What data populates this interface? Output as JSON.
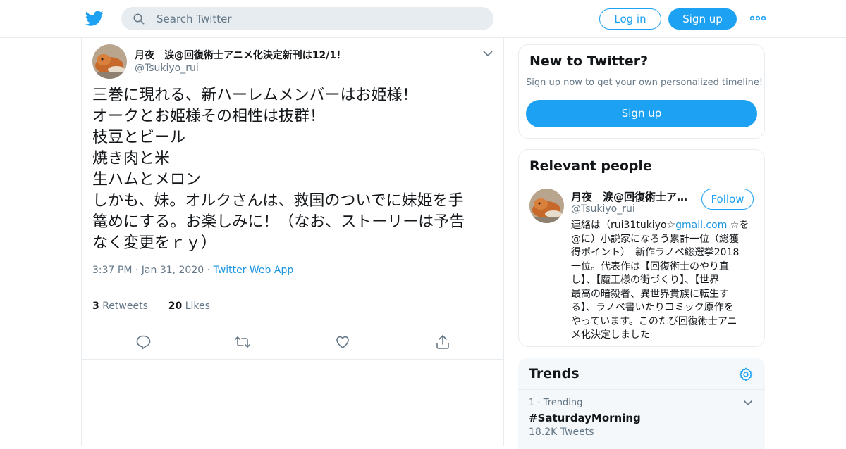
{
  "topbar": {
    "search_placeholder": "Search Twitter",
    "login_label": "Log in",
    "signup_label": "Sign up"
  },
  "tweet": {
    "display_name": "月夜　涙@回復術士アニメ化決定新刊は12/1！",
    "handle": "@Tsukiyo_rui",
    "lines": [
      "三巻に現れる、新ハーレムメンバーはお姫様！",
      "オークとお姫様その相性は抜群！",
      "枝豆とビール",
      "焼き肉と米",
      "生ハムとメロン",
      "しかも、妹。オルクさんは、救国のついでに妹姫を手",
      "篭めにする。お楽しみに！（なお、ストーリーは予告",
      "なく変更をｒｙ）"
    ],
    "time": "3:37 PM",
    "date": "Jan 31, 2020",
    "source": "Twitter Web App",
    "retweets_count": "3",
    "retweets_label": "Retweets",
    "likes_count": "20",
    "likes_label": "Likes"
  },
  "new_to_twitter": {
    "title": "New to Twitter?",
    "subtitle": "Sign up now to get your own personalized timeline!",
    "signup_label": "Sign up"
  },
  "relevant_people": {
    "title": "Relevant people",
    "name": "月夜　涙@回復術士ア…",
    "handle": "@Tsukiyo_rui",
    "follow_label": "Follow",
    "bio_prefix": "連絡は（rui31tukiyo☆",
    "bio_link": "gmail.com",
    "bio_lines": [
      "☆を",
      "@に）小説家になろう累計一位（総獲",
      "得ポイント）　新作ラノベ総選挙2018",
      "一位。代表作は【回復術士のやり直",
      "し】、【魔王様の街づくり】、【世界",
      "最高の暗殺者、異世界貴族に転生す",
      "る】、ラノベ書いたりコミック原作を",
      "やっています。このたび回復術士アニ",
      "メ化決定しました"
    ]
  },
  "trends": {
    "title": "Trends",
    "items": [
      {
        "rank": "1",
        "context": "Trending",
        "name": "#SaturdayMorning",
        "count": "18.2K Tweets"
      }
    ]
  },
  "colors": {
    "accent": "#1da1f2",
    "link": "#1b95e0",
    "muted": "#657786",
    "border": "#e6ecf0"
  }
}
